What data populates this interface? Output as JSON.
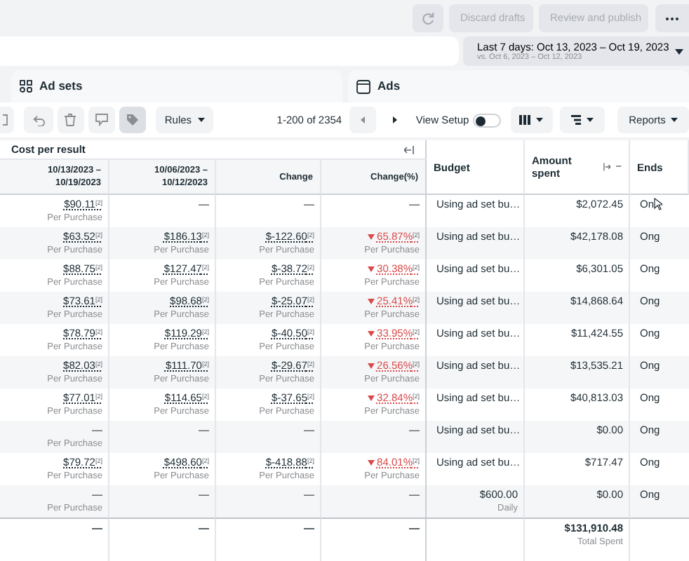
{
  "top_bar": {
    "buttons": [
      {
        "label": "Discard drafts",
        "disabled": true
      },
      {
        "label": "Review and publish",
        "disabled": true
      }
    ]
  },
  "date_range": {
    "label": "Last 7 days: Oct 13, 2023 – Oct 19, 2023",
    "comparison": "vs. Oct 6, 2023 – Oct 12, 2023"
  },
  "tabs": [
    {
      "label": "Ad sets",
      "selected": false
    },
    {
      "label": "Ads",
      "selected": false
    }
  ],
  "toolbar": {
    "rules": "Rules",
    "pagination": "1-200 of 2354",
    "view_setup": {
      "label": "View Setup",
      "on": false
    },
    "reports": "Reports"
  },
  "table": {
    "group_header": "Cost per result",
    "columns": [
      "10/13/2023 – 10/19/2023",
      "10/06/2023 – 10/12/2023",
      "Change",
      "Change(%)",
      "Budget",
      "Amount spent",
      "Ends"
    ],
    "rows": [
      {
        "cells": [
          {
            "value": "$90.11$^{[2]}$",
            "sub": "Per Purchase"
          },
          {
            "value": "—"
          },
          {
            "value": "—"
          },
          {
            "value": "—"
          },
          {
            "value": "Using ad set bu…"
          },
          {
            "value": "$2,072.45"
          },
          {
            "value": "On"
          }
        ]
      },
      {
        "cells": [
          {
            "value": "$63.52$^{[2]}$",
            "sub": "Per Purchase"
          },
          {
            "value": "$186.13$^{[2]}$",
            "sub": "Per Purchase"
          },
          {
            "value": "$-122.60$^{[2]}$",
            "sub": "Per Purchase"
          },
          {
            "value": "65.87%$^{[2]}$",
            "sub": "Per Purchase",
            "decrease": true
          },
          {
            "value": "Using ad set bu…"
          },
          {
            "value": "$42,178.08"
          },
          {
            "value": "Ong"
          }
        ]
      },
      {
        "cells": [
          {
            "value": "$88.75$^{[2]}$",
            "sub": "Per Purchase"
          },
          {
            "value": "$127.47$^{[2]}$",
            "sub": "Per Purchase"
          },
          {
            "value": "$-38.72$^{[2]}$",
            "sub": "Per Purchase"
          },
          {
            "value": "30.38%$^{[2]}$",
            "sub": "Per Purchase",
            "decrease": true
          },
          {
            "value": "Using ad set bu…"
          },
          {
            "value": "$6,301.05"
          },
          {
            "value": "Ong"
          }
        ]
      },
      {
        "cells": [
          {
            "value": "$73.61$^{[2]}$",
            "sub": "Per Purchase"
          },
          {
            "value": "$98.68$^{[2]}$",
            "sub": "Per Purchase"
          },
          {
            "value": "$-25.07$^{[2]}$",
            "sub": "Per Purchase"
          },
          {
            "value": "25.41%$^{[2]}$",
            "sub": "Per Purchase",
            "decrease": true
          },
          {
            "value": "Using ad set bu…"
          },
          {
            "value": "$14,868.64"
          },
          {
            "value": "Ong"
          }
        ]
      },
      {
        "cells": [
          {
            "value": "$78.79$^{[2]}$",
            "sub": "Per Purchase"
          },
          {
            "value": "$119.29$^{[2]}$",
            "sub": "Per Purchase"
          },
          {
            "value": "$-40.50$^{[2]}$",
            "sub": "Per Purchase"
          },
          {
            "value": "33.95%$^{[2]}$",
            "sub": "Per Purchase",
            "decrease": true
          },
          {
            "value": "Using ad set bu…"
          },
          {
            "value": "$11,424.55"
          },
          {
            "value": "Ong"
          }
        ]
      },
      {
        "cells": [
          {
            "value": "$82.03$^{[2]}$",
            "sub": "Per Purchase"
          },
          {
            "value": "$111.70$^{[2]}$",
            "sub": "Per Purchase"
          },
          {
            "value": "$-29.67$^{[2]}$",
            "sub": "Per Purchase"
          },
          {
            "value": "26.56%$^{[2]}$",
            "sub": "Per Purchase",
            "decrease": true
          },
          {
            "value": "Using ad set bu…"
          },
          {
            "value": "$13,535.21"
          },
          {
            "value": "Ong"
          }
        ]
      },
      {
        "cells": [
          {
            "value": "$77.01$^{[2]}$",
            "sub": "Per Purchase"
          },
          {
            "value": "$114.65$^{[2]}$",
            "sub": "Per Purchase"
          },
          {
            "value": "$-37.65$^{[2]}$",
            "sub": "Per Purchase"
          },
          {
            "value": "32.84%$^{[2]}$",
            "sub": "Per Purchase",
            "decrease": true
          },
          {
            "value": "Using ad set bu…"
          },
          {
            "value": "$40,813.03"
          },
          {
            "value": "Ong"
          }
        ]
      },
      {
        "cells": [
          {
            "value": "—",
            "sub": "Per Purchase"
          },
          {
            "value": "—"
          },
          {
            "value": "—"
          },
          {
            "value": "—"
          },
          {
            "value": "Using ad set bu…"
          },
          {
            "value": "$0.00"
          },
          {
            "value": "Ong"
          }
        ]
      },
      {
        "cells": [
          {
            "value": "$79.72$^{[2]}$",
            "sub": "Per Purchase"
          },
          {
            "value": "$498.60$^{[2]}$",
            "sub": "Per Purchase"
          },
          {
            "value": "$-418.88$^{[2]}$",
            "sub": "Per Purchase"
          },
          {
            "value": "84.01%$^{[2]}$",
            "sub": "Per Purchase",
            "decrease": true
          },
          {
            "value": "Using ad set bu…"
          },
          {
            "value": "$717.47"
          },
          {
            "value": "Ong"
          }
        ]
      },
      {
        "cells": [
          {
            "value": "—",
            "sub": "Per Purchase"
          },
          {
            "value": "—"
          },
          {
            "value": "—"
          },
          {
            "value": "—"
          },
          {
            "value": "$600.00",
            "sub": "Daily",
            "kind": "amount"
          },
          {
            "value": "$0.00"
          },
          {
            "value": "Ong"
          }
        ]
      }
    ],
    "totals": {
      "changes": [
        {
          "value": "—"
        },
        {
          "value": "—"
        },
        {
          "value": "—"
        },
        {
          "value": "—"
        }
      ],
      "amount_spent": {
        "value": "$131,910.48",
        "sub": "Total Spent"
      }
    }
  }
}
